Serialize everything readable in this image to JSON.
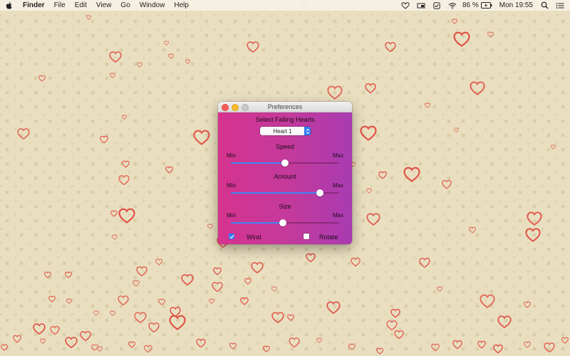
{
  "menubar": {
    "apple_icon": "apple-icon",
    "items": [
      "Finder",
      "File",
      "Edit",
      "View",
      "Go",
      "Window",
      "Help"
    ],
    "battery_percent": "86 %",
    "clock": "Mon 19:55",
    "status_icons": [
      "heart-icon",
      "display-icon",
      "checkmark-badge-icon",
      "wifi-icon",
      "battery-icon",
      "search-icon",
      "list-icon"
    ]
  },
  "window": {
    "title": "Preferences",
    "section_title": "Select Falling Hearts",
    "popup_value": "Heart 1",
    "speed": {
      "label": "Speed",
      "min_label": "Min",
      "max_label": "Max",
      "value": 0.5
    },
    "amount": {
      "label": "Amount",
      "min_label": "Min",
      "max_label": "Max",
      "value": 0.82
    },
    "size": {
      "label": "Size",
      "min_label": "Min",
      "max_label": "Max",
      "value": 0.48
    },
    "wind": {
      "label": "Wind",
      "checked": true
    },
    "rotate": {
      "label": "Rotate",
      "checked": false
    }
  },
  "colors": {
    "heart_stroke": "#e0483e",
    "accent": "#2f7bf2",
    "window_gradient_start": "#d6338e",
    "window_gradient_end": "#a93bb3"
  }
}
